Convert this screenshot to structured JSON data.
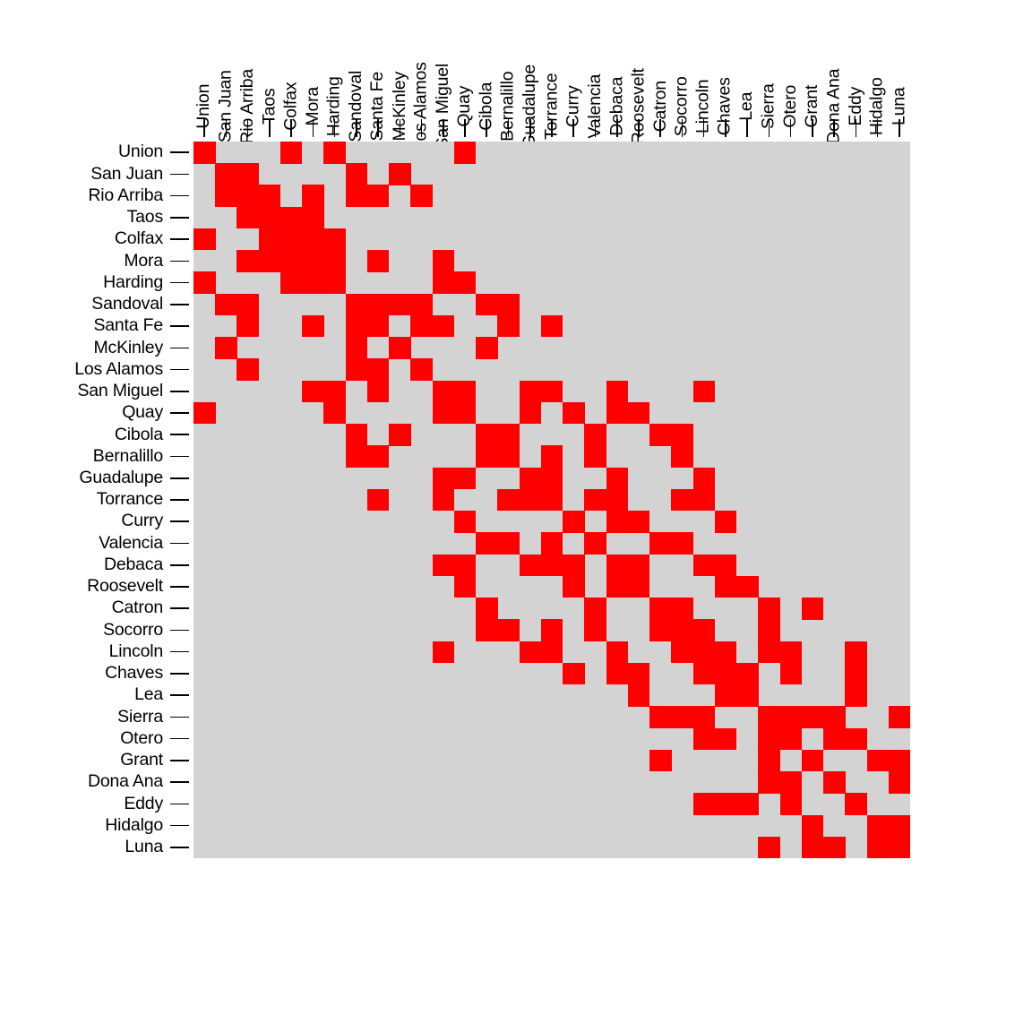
{
  "chart_data": {
    "type": "heatmap",
    "title": "",
    "xlabel": "",
    "ylabel": "",
    "grid": false,
    "legend": "none",
    "description": "Symmetric binary adjacency matrix of the 33 counties of New Mexico. Red cells mark adjacent (or self) county pairs; grey cells mark non-adjacent pairs.",
    "colors": {
      "on": "#ff0000",
      "off": "#d3d3d3",
      "axis": "#000000",
      "background": "#ffffff"
    },
    "value_labels": {
      "on": "adjacent",
      "off": "not adjacent"
    },
    "categories": [
      "Union",
      "San Juan",
      "Rio Arriba",
      "Taos",
      "Colfax",
      "Mora",
      "Harding",
      "Sandoval",
      "Santa Fe",
      "McKinley",
      "Los Alamos",
      "San Miguel",
      "Quay",
      "Cibola",
      "Bernalillo",
      "Guadalupe",
      "Torrance",
      "Curry",
      "Valencia",
      "Debaca",
      "Roosevelt",
      "Catron",
      "Socorro",
      "Lincoln",
      "Chaves",
      "Lea",
      "Sierra",
      "Otero",
      "Grant",
      "Dona Ana",
      "Eddy",
      "Hidalgo",
      "Luna"
    ],
    "x_tick_labels": [
      "Union",
      "San Juan",
      "Rio Arriba",
      "Taos",
      "Colfax",
      "Mora",
      "Harding",
      "Sandoval",
      "Santa Fe",
      "McKinley",
      "Los Alamos",
      "San Miguel",
      "Quay",
      "Cibola",
      "Bernalillo",
      "Guadalupe",
      "Torrance",
      "Curry",
      "Valencia",
      "Debaca",
      "Roosevelt",
      "Catron",
      "Socorro",
      "Lincoln",
      "Chaves",
      "Lea",
      "Sierra",
      "Otero",
      "Grant",
      "Dona Ana",
      "Eddy",
      "Hidalgo",
      "Luna"
    ],
    "y_tick_labels": [
      "Union",
      "San Juan",
      "Rio Arriba",
      "Taos",
      "Colfax",
      "Mora",
      "Harding",
      "Sandoval",
      "Santa Fe",
      "McKinley",
      "Los Alamos",
      "San Miguel",
      "Quay",
      "Cibola",
      "Bernalillo",
      "Guadalupe",
      "Torrance",
      "Curry",
      "Valencia",
      "Debaca",
      "Roosevelt",
      "Catron",
      "Socorro",
      "Lincoln",
      "Chaves",
      "Lea",
      "Sierra",
      "Otero",
      "Grant",
      "Dona Ana",
      "Eddy",
      "Hidalgo",
      "Luna"
    ],
    "n_rows": 33,
    "n_cols": 33,
    "values": [
      [
        1,
        0,
        0,
        0,
        1,
        0,
        1,
        0,
        0,
        0,
        0,
        0,
        1,
        0,
        0,
        0,
        0,
        0,
        0,
        0,
        0,
        0,
        0,
        0,
        0,
        0,
        0,
        0,
        0,
        0,
        0,
        0,
        0
      ],
      [
        0,
        1,
        1,
        0,
        0,
        0,
        0,
        1,
        0,
        1,
        0,
        0,
        0,
        0,
        0,
        0,
        0,
        0,
        0,
        0,
        0,
        0,
        0,
        0,
        0,
        0,
        0,
        0,
        0,
        0,
        0,
        0,
        0
      ],
      [
        0,
        1,
        1,
        1,
        0,
        1,
        0,
        1,
        1,
        0,
        1,
        0,
        0,
        0,
        0,
        0,
        0,
        0,
        0,
        0,
        0,
        0,
        0,
        0,
        0,
        0,
        0,
        0,
        0,
        0,
        0,
        0,
        0
      ],
      [
        0,
        0,
        1,
        1,
        1,
        1,
        0,
        0,
        0,
        0,
        0,
        0,
        0,
        0,
        0,
        0,
        0,
        0,
        0,
        0,
        0,
        0,
        0,
        0,
        0,
        0,
        0,
        0,
        0,
        0,
        0,
        0,
        0
      ],
      [
        1,
        0,
        0,
        1,
        1,
        1,
        1,
        0,
        0,
        0,
        0,
        0,
        0,
        0,
        0,
        0,
        0,
        0,
        0,
        0,
        0,
        0,
        0,
        0,
        0,
        0,
        0,
        0,
        0,
        0,
        0,
        0,
        0
      ],
      [
        0,
        0,
        1,
        1,
        1,
        1,
        1,
        0,
        1,
        0,
        0,
        1,
        0,
        0,
        0,
        0,
        0,
        0,
        0,
        0,
        0,
        0,
        0,
        0,
        0,
        0,
        0,
        0,
        0,
        0,
        0,
        0,
        0
      ],
      [
        1,
        0,
        0,
        0,
        1,
        1,
        1,
        0,
        0,
        0,
        0,
        1,
        1,
        0,
        0,
        0,
        0,
        0,
        0,
        0,
        0,
        0,
        0,
        0,
        0,
        0,
        0,
        0,
        0,
        0,
        0,
        0,
        0
      ],
      [
        0,
        1,
        1,
        0,
        0,
        0,
        0,
        1,
        1,
        1,
        1,
        0,
        0,
        1,
        1,
        0,
        0,
        0,
        0,
        0,
        0,
        0,
        0,
        0,
        0,
        0,
        0,
        0,
        0,
        0,
        0,
        0,
        0
      ],
      [
        0,
        0,
        1,
        0,
        0,
        1,
        0,
        1,
        1,
        0,
        1,
        1,
        0,
        0,
        1,
        0,
        1,
        0,
        0,
        0,
        0,
        0,
        0,
        0,
        0,
        0,
        0,
        0,
        0,
        0,
        0,
        0,
        0
      ],
      [
        0,
        1,
        0,
        0,
        0,
        0,
        0,
        1,
        0,
        1,
        0,
        0,
        0,
        1,
        0,
        0,
        0,
        0,
        0,
        0,
        0,
        0,
        0,
        0,
        0,
        0,
        0,
        0,
        0,
        0,
        0,
        0,
        0
      ],
      [
        0,
        0,
        1,
        0,
        0,
        0,
        0,
        1,
        1,
        0,
        1,
        0,
        0,
        0,
        0,
        0,
        0,
        0,
        0,
        0,
        0,
        0,
        0,
        0,
        0,
        0,
        0,
        0,
        0,
        0,
        0,
        0,
        0
      ],
      [
        0,
        0,
        0,
        0,
        0,
        1,
        1,
        0,
        1,
        0,
        0,
        1,
        1,
        0,
        0,
        1,
        1,
        0,
        0,
        1,
        0,
        0,
        0,
        1,
        0,
        0,
        0,
        0,
        0,
        0,
        0,
        0,
        0
      ],
      [
        1,
        0,
        0,
        0,
        0,
        0,
        1,
        0,
        0,
        0,
        0,
        1,
        1,
        0,
        0,
        1,
        0,
        1,
        0,
        1,
        1,
        0,
        0,
        0,
        0,
        0,
        0,
        0,
        0,
        0,
        0,
        0,
        0
      ],
      [
        0,
        0,
        0,
        0,
        0,
        0,
        0,
        1,
        0,
        1,
        0,
        0,
        0,
        1,
        1,
        0,
        0,
        0,
        1,
        0,
        0,
        1,
        1,
        0,
        0,
        0,
        0,
        0,
        0,
        0,
        0,
        0,
        0
      ],
      [
        0,
        0,
        0,
        0,
        0,
        0,
        0,
        1,
        1,
        0,
        0,
        0,
        0,
        1,
        1,
        0,
        1,
        0,
        1,
        0,
        0,
        0,
        1,
        0,
        0,
        0,
        0,
        0,
        0,
        0,
        0,
        0,
        0
      ],
      [
        0,
        0,
        0,
        0,
        0,
        0,
        0,
        0,
        0,
        0,
        0,
        1,
        1,
        0,
        0,
        1,
        1,
        0,
        0,
        1,
        0,
        0,
        0,
        1,
        0,
        0,
        0,
        0,
        0,
        0,
        0,
        0,
        0
      ],
      [
        0,
        0,
        0,
        0,
        0,
        0,
        0,
        0,
        1,
        0,
        0,
        1,
        0,
        0,
        1,
        1,
        1,
        0,
        1,
        1,
        0,
        0,
        1,
        1,
        0,
        0,
        0,
        0,
        0,
        0,
        0,
        0,
        0
      ],
      [
        0,
        0,
        0,
        0,
        0,
        0,
        0,
        0,
        0,
        0,
        0,
        0,
        1,
        0,
        0,
        0,
        0,
        1,
        0,
        1,
        1,
        0,
        0,
        0,
        1,
        0,
        0,
        0,
        0,
        0,
        0,
        0,
        0
      ],
      [
        0,
        0,
        0,
        0,
        0,
        0,
        0,
        0,
        0,
        0,
        0,
        0,
        0,
        1,
        1,
        0,
        1,
        0,
        1,
        0,
        0,
        1,
        1,
        0,
        0,
        0,
        0,
        0,
        0,
        0,
        0,
        0,
        0
      ],
      [
        0,
        0,
        0,
        0,
        0,
        0,
        0,
        0,
        0,
        0,
        0,
        1,
        1,
        0,
        0,
        1,
        1,
        1,
        0,
        1,
        1,
        0,
        0,
        1,
        1,
        0,
        0,
        0,
        0,
        0,
        0,
        0,
        0
      ],
      [
        0,
        0,
        0,
        0,
        0,
        0,
        0,
        0,
        0,
        0,
        0,
        0,
        1,
        0,
        0,
        0,
        0,
        1,
        0,
        1,
        1,
        0,
        0,
        0,
        1,
        1,
        0,
        0,
        0,
        0,
        0,
        0,
        0
      ],
      [
        0,
        0,
        0,
        0,
        0,
        0,
        0,
        0,
        0,
        0,
        0,
        0,
        0,
        1,
        0,
        0,
        0,
        0,
        1,
        0,
        0,
        1,
        1,
        0,
        0,
        0,
        1,
        0,
        1,
        0,
        0,
        0,
        0
      ],
      [
        0,
        0,
        0,
        0,
        0,
        0,
        0,
        0,
        0,
        0,
        0,
        0,
        0,
        1,
        1,
        0,
        1,
        0,
        1,
        0,
        0,
        1,
        1,
        1,
        0,
        0,
        1,
        0,
        0,
        0,
        0,
        0,
        0
      ],
      [
        0,
        0,
        0,
        0,
        0,
        0,
        0,
        0,
        0,
        0,
        0,
        1,
        0,
        0,
        0,
        1,
        1,
        0,
        0,
        1,
        0,
        0,
        1,
        1,
        1,
        0,
        1,
        1,
        0,
        0,
        1,
        0,
        0
      ],
      [
        0,
        0,
        0,
        0,
        0,
        0,
        0,
        0,
        0,
        0,
        0,
        0,
        0,
        0,
        0,
        0,
        0,
        1,
        0,
        1,
        1,
        0,
        0,
        1,
        1,
        1,
        0,
        1,
        0,
        0,
        1,
        0,
        0
      ],
      [
        0,
        0,
        0,
        0,
        0,
        0,
        0,
        0,
        0,
        0,
        0,
        0,
        0,
        0,
        0,
        0,
        0,
        0,
        0,
        0,
        1,
        0,
        0,
        0,
        1,
        1,
        0,
        0,
        0,
        0,
        1,
        0,
        0
      ],
      [
        0,
        0,
        0,
        0,
        0,
        0,
        0,
        0,
        0,
        0,
        0,
        0,
        0,
        0,
        0,
        0,
        0,
        0,
        0,
        0,
        0,
        1,
        1,
        1,
        0,
        0,
        1,
        1,
        1,
        1,
        0,
        0,
        1
      ],
      [
        0,
        0,
        0,
        0,
        0,
        0,
        0,
        0,
        0,
        0,
        0,
        0,
        0,
        0,
        0,
        0,
        0,
        0,
        0,
        0,
        0,
        0,
        0,
        1,
        1,
        0,
        1,
        1,
        0,
        1,
        1,
        0,
        0
      ],
      [
        0,
        0,
        0,
        0,
        0,
        0,
        0,
        0,
        0,
        0,
        0,
        0,
        0,
        0,
        0,
        0,
        0,
        0,
        0,
        0,
        0,
        1,
        0,
        0,
        0,
        0,
        1,
        0,
        1,
        0,
        0,
        1,
        1
      ],
      [
        0,
        0,
        0,
        0,
        0,
        0,
        0,
        0,
        0,
        0,
        0,
        0,
        0,
        0,
        0,
        0,
        0,
        0,
        0,
        0,
        0,
        0,
        0,
        0,
        0,
        0,
        1,
        1,
        0,
        1,
        0,
        0,
        1
      ],
      [
        0,
        0,
        0,
        0,
        0,
        0,
        0,
        0,
        0,
        0,
        0,
        0,
        0,
        0,
        0,
        0,
        0,
        0,
        0,
        0,
        0,
        0,
        0,
        1,
        1,
        1,
        0,
        1,
        0,
        0,
        1,
        0,
        0
      ],
      [
        0,
        0,
        0,
        0,
        0,
        0,
        0,
        0,
        0,
        0,
        0,
        0,
        0,
        0,
        0,
        0,
        0,
        0,
        0,
        0,
        0,
        0,
        0,
        0,
        0,
        0,
        0,
        0,
        1,
        0,
        0,
        1,
        1
      ],
      [
        0,
        0,
        0,
        0,
        0,
        0,
        0,
        0,
        0,
        0,
        0,
        0,
        0,
        0,
        0,
        0,
        0,
        0,
        0,
        0,
        0,
        0,
        0,
        0,
        0,
        0,
        1,
        0,
        1,
        1,
        0,
        1,
        1
      ]
    ]
  }
}
